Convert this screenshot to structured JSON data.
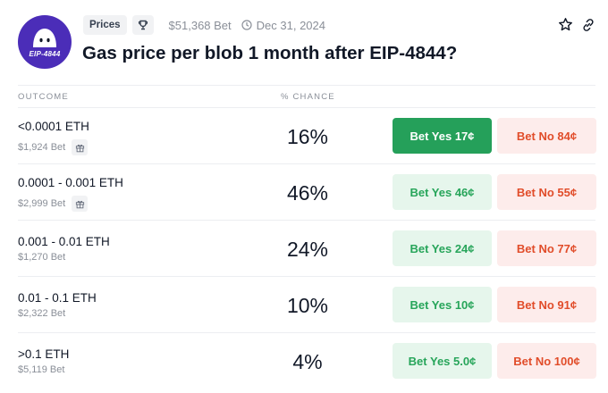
{
  "market": {
    "logo_text": "EIP-4844",
    "category": "Prices",
    "volume": "$51,368 Bet",
    "end_date": "Dec 31, 2024",
    "title": "Gas price per blob 1 month after EIP-4844?"
  },
  "table": {
    "outcome_header": "OUTCOME",
    "chance_header": "% CHANCE"
  },
  "outcomes": [
    {
      "name": "<0.0001 ETH",
      "volume": "$1,924 Bet",
      "gift": true,
      "chance": "16%",
      "yes": "Bet Yes 17¢",
      "no": "Bet No 84¢",
      "yes_active": true
    },
    {
      "name": "0.0001 - 0.001 ETH",
      "volume": "$2,999 Bet",
      "gift": true,
      "chance": "46%",
      "yes": "Bet Yes 46¢",
      "no": "Bet No 55¢",
      "yes_active": false
    },
    {
      "name": "0.001 - 0.01 ETH",
      "volume": "$1,270 Bet",
      "gift": false,
      "chance": "24%",
      "yes": "Bet Yes 24¢",
      "no": "Bet No 77¢",
      "yes_active": false
    },
    {
      "name": "0.01 - 0.1 ETH",
      "volume": "$2,322 Bet",
      "gift": false,
      "chance": "10%",
      "yes": "Bet Yes 10¢",
      "no": "Bet No 91¢",
      "yes_active": false
    },
    {
      "name": ">0.1 ETH",
      "volume": "$5,119 Bet",
      "gift": false,
      "chance": "4%",
      "yes": "Bet Yes 5.0¢",
      "no": "Bet No 100¢",
      "yes_active": false
    }
  ],
  "icons": {
    "category_icon": "trophy-icon",
    "date_icon": "clock-icon",
    "watch_icon": "star-icon",
    "share_icon": "link-icon",
    "volume_badge_icon": "gift-icon"
  },
  "colors": {
    "logo_bg": "#4b2db8",
    "yes_active_bg": "#25a05a",
    "yes_bg": "#e6f6ec",
    "yes_text": "#27a55a",
    "no_bg": "#fdeceb",
    "no_text": "#e14d2a"
  }
}
